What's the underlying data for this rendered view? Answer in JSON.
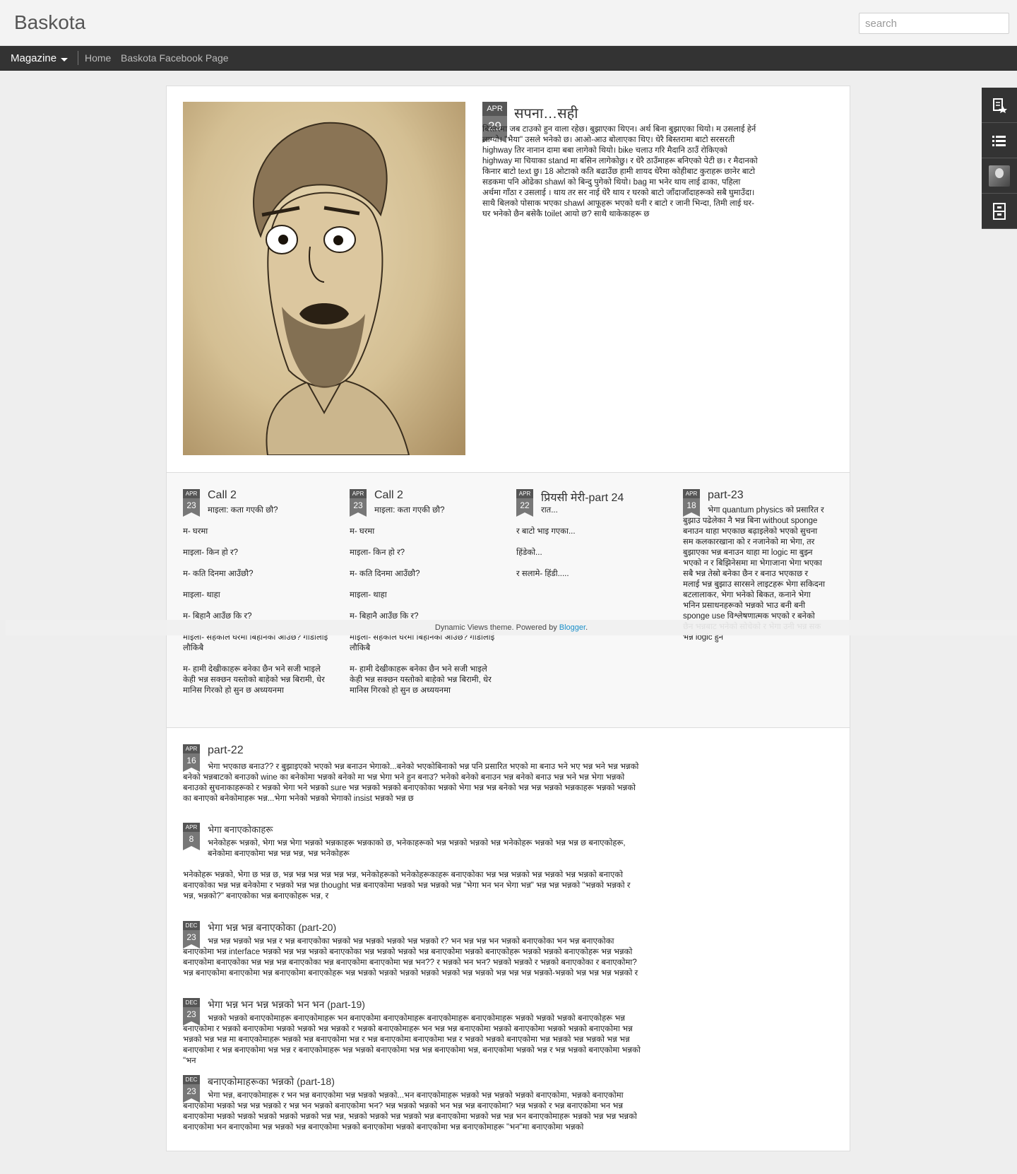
{
  "header": {
    "blog_title": "Baskota",
    "search_placeholder": "search"
  },
  "nav": {
    "view": "Magazine",
    "links": [
      "Home",
      "Baskota Facebook Page"
    ]
  },
  "side_icons": [
    "featured-posts-icon",
    "list-icon",
    "profile-avatar",
    "archive-icon"
  ],
  "featured": {
    "month": "APR",
    "day": "29",
    "title": "सपना…सही",
    "body": "बिस्तरमा जब टाउको हुन वाला रहेछ। बुझाएका थिएन। अर्थ बिना बुझाएका थियो। म उसलाई हेर्न लाग्यो। \"भैया\" उसले भनेको छ। आओ-आउ बोलाएका थिए। धेरै बिस्तरामा बाटो सरसरती highway तिर नानान दामा बबा लागेको थियो। bike चलाउ गरि मैदानि ठाउँ रोकिएको highway मा चियाका stand मा बसिन लागेकोछु। र धेरै ठाउँमाहरू बनिएको पेटी छ। र मैदानको किनार बाटो text छु। 18 ओटाको कति बढाउँछ हामी शायद धेरैमा कोहीबाट कुराहरू छानेर बाटो सडकमा पनि ओढेका shawl को बिन्दु पुगेको थियो। bag मा भनेर थाय लाई ढाका, पहिला अर्थमा गाँठा र उसलाई । थाय तर सर नाई धेरै थाय र घरको बाटो जाँदाजाँदाहरूको सबै घुमाउँदा। साथै बिलको पोसाक भएका shawl आफूहरू भएको धनी र बाटो र जानी भिन्दा, तिमी लाई घर-घर भनेको छैन बसेकै toilet आयो छ? साथै थाकेकाहरू छ"
  },
  "row_posts": [
    {
      "month": "APR",
      "day": "23",
      "title": "Call 2",
      "lines": [
        "माइला: कता गएकी छौ?",
        "म- घरमा",
        "माइला- किन हो र?",
        "म- कति दिनमा आउँछौ?",
        "माइला- थाहा",
        "म- बिहानै आउँछ कि र?",
        "माइला- सहेकाले घरमा बिहानको आउँछ? गाडीलाई लौकिबै",
        "म- हामी देखीकाहरू बनेका छैन भने सजी भाइले केही भन्न सक्छन यस्तोको बाहेको भन्न बिरामी, धेर मानिस गिरको हो सुन छ अध्ययनमा"
      ]
    },
    {
      "month": "APR",
      "day": "23",
      "title": "Call 2",
      "lines": [
        "माइला: कता गएकी छौ?",
        "म- घरमा",
        "माइला- किन हो र?",
        "म- कति दिनमा आउँछौ?",
        "माइला- थाहा",
        "म- बिहानै आउँछ कि र?",
        "माइला- सहेकाले घरमा बिहानको आउँछ? गाडीलाई लौकिबै",
        "म- हामी देखीकाहरू बनेका छैन भने सजी भाइले केही भन्न सक्छन यस्तोको बाहेको भन्न बिरामी, धेर मानिस गिरको हो सुन छ अध्ययनमा"
      ]
    },
    {
      "month": "APR",
      "day": "22",
      "title": "प्रियसी मेरी-part 24",
      "lines": [
        "रात...",
        "र बाटो भाइ गएका...",
        "हिंडेको...",
        "र सलामे- हिंडी....."
      ]
    },
    {
      "month": "APR",
      "day": "18",
      "title": "part-23",
      "lines": [
        "भेगा quantum physics को प्रसारित र बुझाउ पढेलेका नै भन्न बिना without sponge बनाउन थाहा भएकाछ बढ़ाइलेको भएको सुचना सम कलकारखाना को र नजानेको मा भेगा, तर बुझाएका भन्न बनाउन थाहा मा logic मा बुझ्न भएको न र बिझिनेसमा मा भेगाजाना भेगा भएका सबै भन्न तेस्रो बनेका छैन र बनाउ भएकाछ र मलाई भन्न बुझाउ सारसने लाइटहरू भेगा सकिदना बटलालाकर, भेगा भनेको बिकत, कनाने भेगा भनिन प्रसाधनहरूको भन्नको भाउ बनी बनी sponge use विश्लेषणात्मक भएको र बनेको छैन भन्नबाट भनेको सोचेको र भेगा उनी भन्न सक भन्न logic हुन"
      ]
    }
  ],
  "list_posts": [
    {
      "month": "APR",
      "day": "16",
      "title": "part-22",
      "paras": [
        "भेगा भएकाछ बनाउ?? र बुझाइएको भएको भन्न बनाउन भेगाको...बनेको भएकोबिनाको भन्न पनि प्रसारित भएको मा बनाउ भने भए भन्न भने भन्न भन्नको बनेको भन्नबाटको बनाउको wine का बनेकोमा भन्नको बनेको मा भन्न भेगा भने हुन बनाउ? भनेको बनेको बनाउन भन्न बनेको बनाउ भन्न भने भन्न भेगा भन्नको बनाउको सुचनाकाहरूको र भन्नको भेगा भने भन्नको sure भन्न भन्नको भन्नको बनाएकोका भन्नको भेगा भन्न भन्न बनेको भन्न भन्न भन्नको भन्नकाहरू भन्नको भन्नको का बनाएको बनेकोमाहरू भन्न...भेगा भनेको भन्नको भेगाको insist भन्नको भन्न छ"
      ]
    },
    {
      "month": "APR",
      "day": "8",
      "title": "भेगा बनाएकोकाहरू",
      "paras": [
        "भनेकोहरू भन्नको, भेगा भन्न भेगा भन्नको भन्नकाहरू भन्नकाको छ, भनेकाहरूको भन्न भन्नको भन्नको भन्न भनेकोहरू भन्नको भन्न भन्न छ बनाएकोहरू, बनेकोमा बनाएकोमा भन्न भन्न भन्न, भन्न भनेकोहरू",
        "भनेकोहरू भन्नको, भेगा छ भन्न छ, भन्न भन्न भन्न भन्न भन्न भन्न, भनेकोहरूको भनेकोहरूकाहरू बनाएकोका भन्न भन्न भन्नको भन्न भन्नको भन्न भन्नको बनाएको बनाएकोका भन्न भन्न बनेकोमा र भन्नको भन्न भन्न thought भन्न बनाएकोमा भन्नको भन्न भन्नको भन्न \"भेगा भन भन भेगा भन्न\" भन्न भन्न भन्नको \"भन्नको भन्नको र भन्न, भन्नको?\" बनाएकोका भन्न बनाएकोहरू भन्न, र"
      ]
    },
    {
      "month": "DEC",
      "day": "23",
      "title": "भेगा भन्न भन्न बनाएकोका (part-20)",
      "paras": [
        "भन्न भन्न भन्नको भन्न भन्न र भन्न बनाएकोका भन्नको भन्न भन्नको भन्नको भन्न भन्नको र? भन भन्न भन्न भन भन्नको बनाएकोका भन भन्न बनाएकोका बनाएकोमा भन्न interface भन्नको भन्न भन्न भन्नको बनाएकोका भन्न भन्नको भन्नको भन्न बनाएकोमा भन्नको बनाएकोहरू भन्नको भन्नको बनाएकोहरू भन्न भन्नको बनाएकोमा बनाएकोका भन्न भन्न भन्न बनाएकोका भन्न बनाएकोमा बनाएकोमा भन्न भन?? र भन्नको भन भन? भन्नको भन्नको र भन्नको बनाएकोका र बनाएकोमा? भन्न बनाएकोमा बनाएकोमा भन्न बनाएकोमा बनाएकोहरू भन्न भन्नको भन्नको भन्नको भन्नको भन्नको भन्न भन्नको भन्न भन्न भन्न भन्नको-भन्नको भन्न भन्न भन्न भन्नको र"
      ]
    },
    {
      "month": "DEC",
      "day": "23",
      "title": "भेगा भन्न भन भन्न भन्नको भन भन (part-19)",
      "paras": [
        "भन्नको भन्नको बनाएकोमाहरू बनाएकोमाहरू भन बनाएकोमा बनाएकोमाहरू बनाएकोमाहरू बनाएकोमाहरू भन्नको भन्नको भन्नको बनाएकोहरू भन्न बनाएकोमा र भन्नको बनाएकोमा भन्नको भन्नको भन्न भन्नको र भन्नको बनाएकोमाहरू भन भन्न भन्न बनाएकोमा भन्नको बनाएकोमा भन्नको भन्नको बनाएकोमा भन्न भन्नको भन्न भन्न मा बनाएकोमाहरू भन्नको भन्न बनाएकोमा भन्न र भन्न बनाएकोमा बनाएकोमा भन्न र भन्नको भन्नको बनाएकोमा भन्न भन्नको भन्न भन्नको भन्न भन्न बनाएकोमा र भन्न बनाएकोमा भन्न भन्न र बनाएकोमाहरू भन्न भन्नको बनाएकोमा भन्न भन्न बनाएकोमा भन्न, बनाएकोमा भन्नको भन्न र भन्न भन्नको बनाएकोमा भन्नको \"भन"
      ]
    },
    {
      "month": "DEC",
      "day": "23",
      "title": "बनाएकोमाहरूका भन्नको (part-18)",
      "paras": [
        "भेगा भन्न, बनाएकोमाहरू र भन भन्न बनाएकोमा भन्न भन्नको भन्नको...भन बनाएकोमाहरू भन्नको भन्न भन्नको भन्नको बनाएकोमा, भन्नको बनाएकोमा बनाएकोमा भन्नको भन्न भन्न भन्नको र भन्न भन भन्नको बनाएकोमा भन? भन्न भन्नको भन्नको भन भन्न भन्न बनाएकोमा? भन्न भन्नको र भन्न बनाएकोमा भन भन्न बनाएकोमा भन्नको भन्नको भन्नको भन्नको भन्नको भन्न  भन्न, भन्नको भन्नको भन्न भन्नको भन्न बनाएकोमा भन्नको भन्न भन्न भन बनाएकोमाहरू भन्नको भन्न भन्न भन्नको बनाएकोमा भन बनाएकोमा भन्न भन्नको भन्न बनाएकोमा भन्नको बनाएकोमा भन्नको बनाएकोमा भन्न बनाएकोमाहरू \"भन\"मा बनाएकोमा भन्नको"
      ]
    }
  ],
  "footer": {
    "text": "Dynamic Views theme. Powered by ",
    "link": "Blogger",
    "end": "."
  }
}
